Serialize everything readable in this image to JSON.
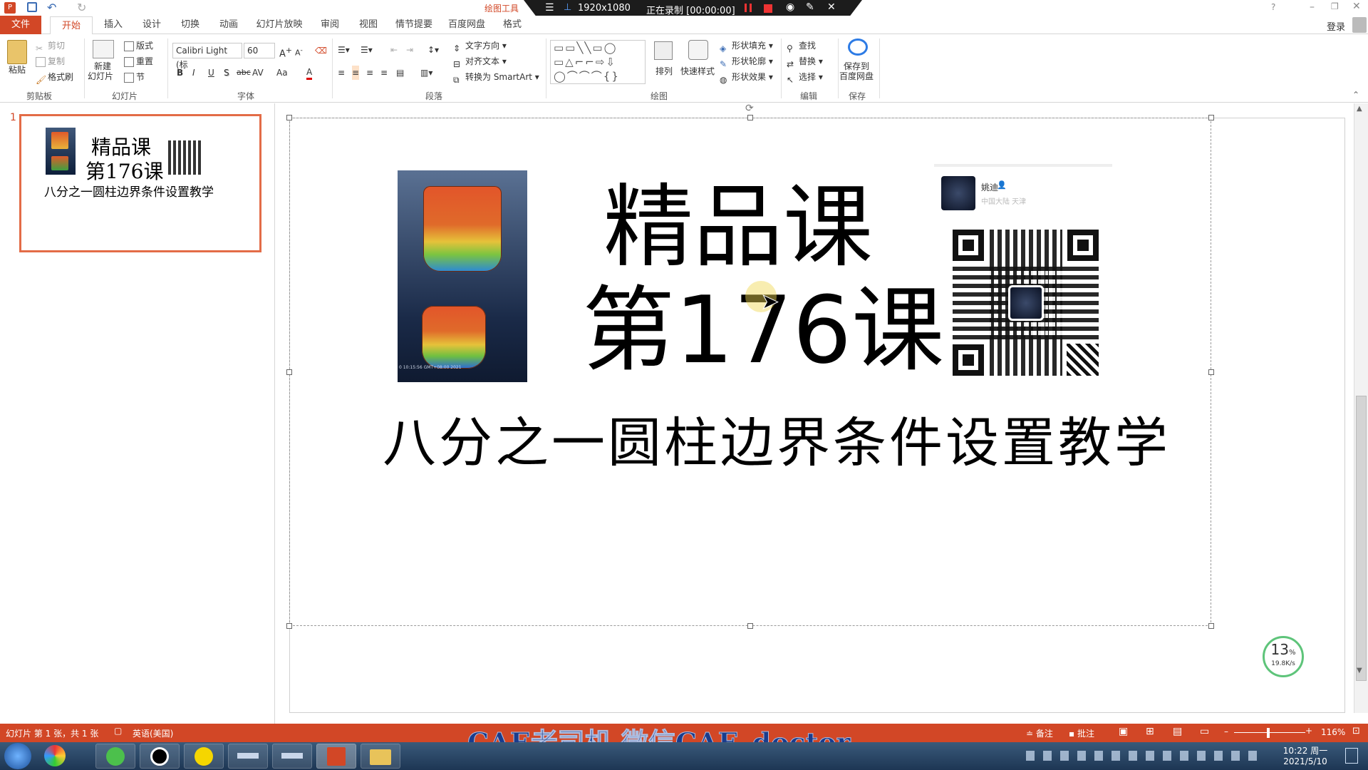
{
  "window": {
    "title_tools": "绘图工具",
    "login": "登录"
  },
  "recorder": {
    "resolution": "1920x1080",
    "status": "正在录制 [00:00:00]"
  },
  "tabs": [
    "文件",
    "开始",
    "插入",
    "设计",
    "切换",
    "动画",
    "幻灯片放映",
    "审阅",
    "视图",
    "情节提要",
    "百度网盘",
    "格式"
  ],
  "ribbon": {
    "clipboard": {
      "paste": "粘贴",
      "cut": "剪切",
      "copy": "复制",
      "format_painter": "格式刷",
      "label": "剪贴板"
    },
    "slides": {
      "new_slide_1": "新建",
      "new_slide_2": "幻灯片",
      "layout": "版式",
      "reset": "重置",
      "section": "节",
      "label": "幻灯片"
    },
    "font": {
      "name": "Calibri Light (标",
      "size": "60",
      "label": "字体",
      "bold": "B",
      "italic": "I",
      "underline": "U",
      "shadow": "S",
      "strike": "abc",
      "spacing": "AV",
      "case": "Aa",
      "color": "A"
    },
    "paragraph": {
      "text_direction": "文字方向",
      "align_text": "对齐文本",
      "smartart": "转换为 SmartArt",
      "label": "段落"
    },
    "drawing": {
      "arrange": "排列",
      "quick_styles": "快速样式",
      "shape_fill": "形状填充",
      "shape_outline": "形状轮廓",
      "shape_effects": "形状效果",
      "label": "绘图"
    },
    "editing": {
      "find": "查找",
      "replace": "替换",
      "select": "选择",
      "label": "编辑"
    },
    "save": {
      "line1": "保存到",
      "line2": "百度网盘",
      "label": "保存"
    }
  },
  "thumbnail": {
    "number": "1",
    "title1": "精品课",
    "title2": "第176课",
    "subtitle": "八分之一圆柱边界条件设置教学"
  },
  "slide": {
    "title_line1": "精品课",
    "title_line2": "第176课",
    "subtitle": "八分之一圆柱边界条件设置教学",
    "profile_name": "姚迪",
    "profile_location": "中国大陆 天津",
    "image_caption": "0 10:15:56 GMT+08:00 2021"
  },
  "speed_widget": {
    "percent": "13",
    "unit": "%",
    "rate": "19.8K/s"
  },
  "status": {
    "slide_info": "幻灯片 第 1 张，共 1 张",
    "language": "英语(美国)",
    "notes": "备注",
    "comments": "批注",
    "zoom": "116%"
  },
  "watermark": "CAE老司机  微信CAE_doctor",
  "clock": {
    "time": "10:22 周一",
    "date": "2021/5/10"
  },
  "colors": {
    "accent": "#d24726",
    "thumb_border": "#e36c47",
    "watermark": "#1a3c8c"
  }
}
